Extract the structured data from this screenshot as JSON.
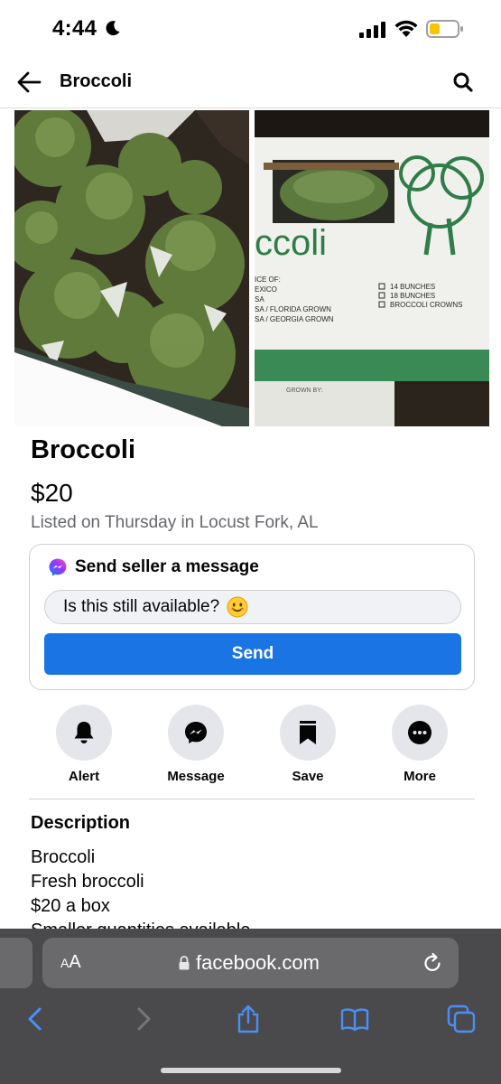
{
  "status_bar": {
    "time": "4:44"
  },
  "header": {
    "title": "Broccoli"
  },
  "photos": {
    "box_brand": "ccoli",
    "box_left_lines": [
      "ICE OF:",
      "EXICO",
      "SA",
      "SA / FLORIDA GROWN",
      "SA / GEORGIA GROWN"
    ],
    "box_right_lines": [
      "14 BUNCHES",
      "18 BUNCHES",
      "BROCCOLI CROWNS"
    ],
    "box_bottom": "GROWN BY:"
  },
  "listing": {
    "title": "Broccoli",
    "price": "$20",
    "listed": "Listed on Thursday in Locust Fork, AL"
  },
  "message_card": {
    "title": "Send seller a message",
    "input_value": "Is this still available?",
    "send_label": "Send"
  },
  "actions": [
    {
      "label": "Alert",
      "icon": "bell-icon"
    },
    {
      "label": "Message",
      "icon": "messenger-icon"
    },
    {
      "label": "Save",
      "icon": "bookmark-icon"
    },
    {
      "label": "More",
      "icon": "more-icon"
    }
  ],
  "description": {
    "heading": "Description",
    "lines": [
      "Broccoli",
      "Fresh broccoli",
      "$20 a box",
      "Smaller quantities available"
    ]
  },
  "browser": {
    "aa_label_small": "A",
    "aa_label_large": "A",
    "url": "facebook.com"
  },
  "colors": {
    "accent": "#1b74e4",
    "secondary_text": "#65676b",
    "safari_bar": "#4a4a4d",
    "ios_blue": "#4a8ff7"
  }
}
